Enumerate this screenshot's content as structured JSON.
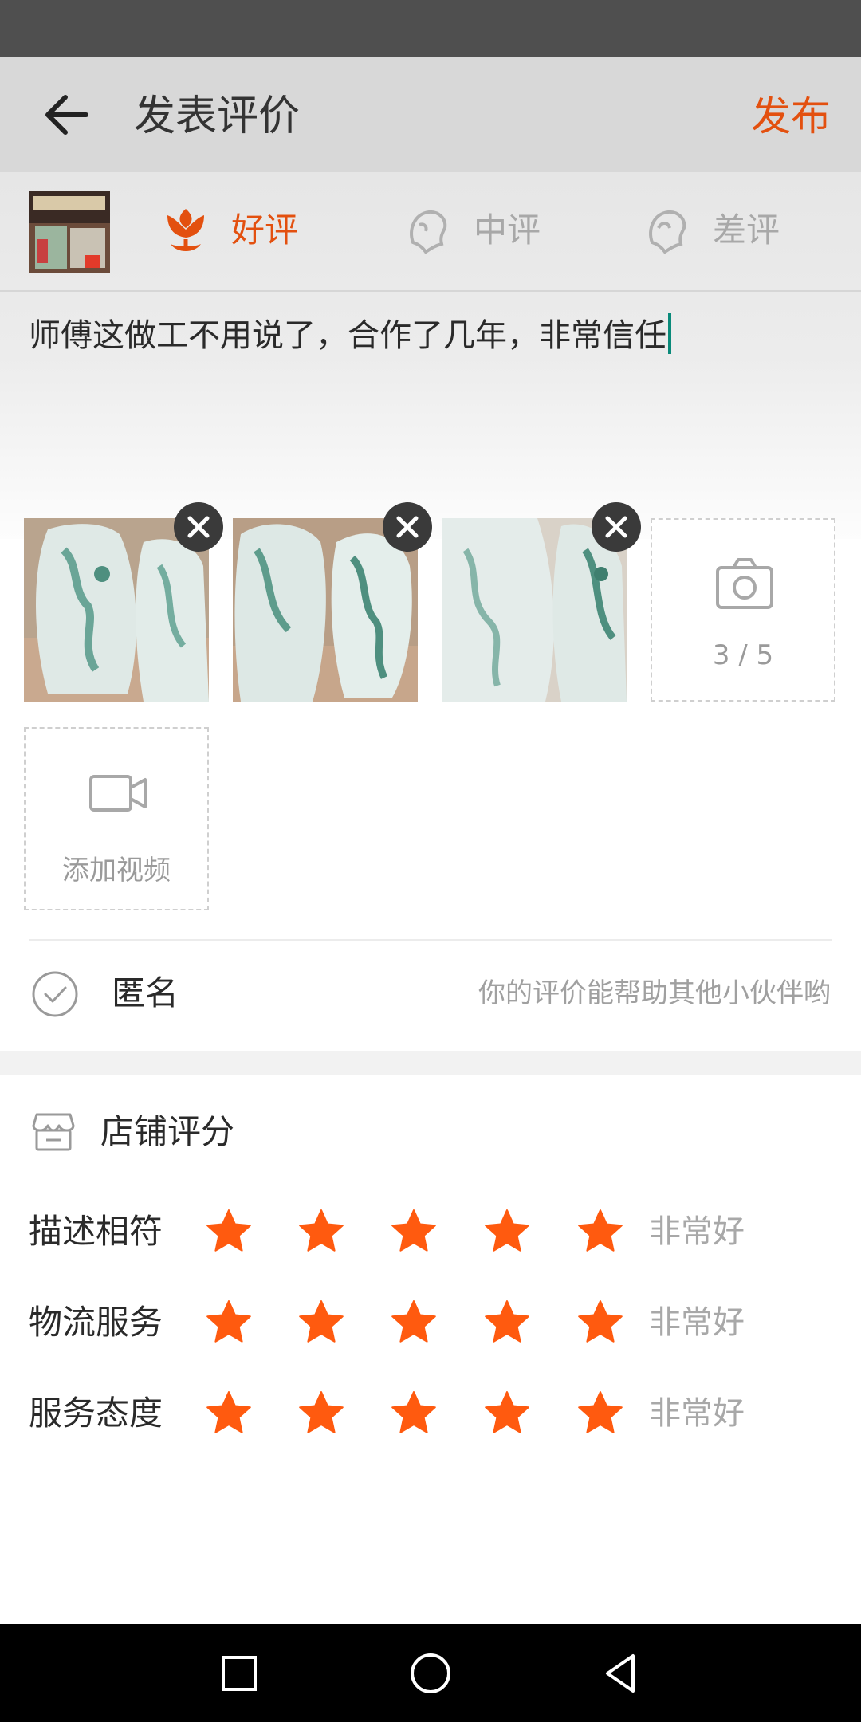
{
  "app_bar": {
    "title": "发表评价",
    "publish_label": "发布"
  },
  "rating_options": [
    {
      "label": "好评",
      "selected": true
    },
    {
      "label": "中评",
      "selected": false
    },
    {
      "label": "差评",
      "selected": false
    }
  ],
  "review": {
    "text": "师傅这做工不用说了，合作了几年，非常信任"
  },
  "photos": {
    "count_label": "3 / 5",
    "count": 3,
    "max": 5
  },
  "video": {
    "add_label": "添加视频"
  },
  "anonymous": {
    "label": "匿名",
    "hint": "你的评价能帮助其他小伙伴哟"
  },
  "store_rating": {
    "title": "店铺评分",
    "rows": [
      {
        "label": "描述相符",
        "stars": 5,
        "text": "非常好"
      },
      {
        "label": "物流服务",
        "stars": 5,
        "text": "非常好"
      },
      {
        "label": "服务态度",
        "stars": 5,
        "text": "非常好"
      }
    ]
  },
  "colors": {
    "accent": "#e3500f",
    "star": "#ff5a0f",
    "muted": "#a8a8a8"
  }
}
